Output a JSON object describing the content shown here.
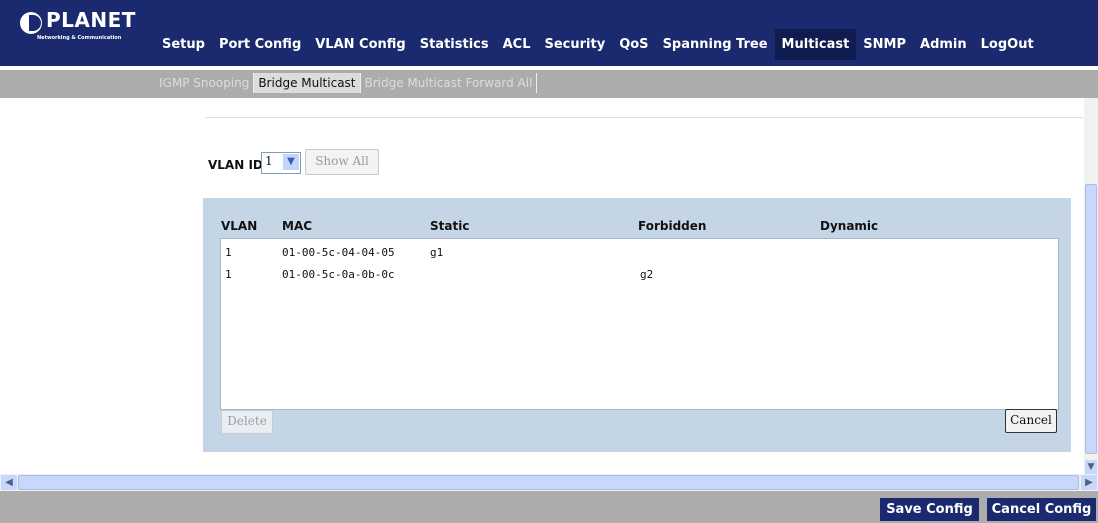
{
  "brand": {
    "name": "PLANET",
    "tagline": "Networking & Communication"
  },
  "nav": {
    "items": [
      "Setup",
      "Port Config",
      "VLAN Config",
      "Statistics",
      "ACL",
      "Security",
      "QoS",
      "Spanning Tree",
      "Multicast",
      "SNMP",
      "Admin",
      "LogOut"
    ],
    "active": "Multicast"
  },
  "subnav": {
    "items": [
      "IGMP Snooping",
      "Bridge Multicast",
      "Bridge Multicast Forward All"
    ],
    "active": "Bridge Multicast"
  },
  "filter": {
    "vlan_label": "VLAN ID",
    "vlan_value": "1",
    "show_all_label": "Show All"
  },
  "table": {
    "headers": {
      "vlan": "VLAN",
      "mac": "MAC",
      "static": "Static",
      "forbidden": "Forbidden",
      "dynamic": "Dynamic"
    },
    "rows": [
      {
        "vlan": "1",
        "mac": "01-00-5c-04-04-05",
        "static": "g1",
        "forbidden": "",
        "dynamic": ""
      },
      {
        "vlan": "1",
        "mac": "01-00-5c-0a-0b-0c",
        "static": "",
        "forbidden": "g2",
        "dynamic": ""
      }
    ],
    "delete_label": "Delete",
    "cancel_label": "Cancel"
  },
  "footer": {
    "save_label": "Save Config",
    "cancel_label": "Cancel Config"
  },
  "colors": {
    "nav_bg": "#1b2a6f",
    "active_nav_bg": "#101b4f",
    "panel_bg": "#c4d6e6",
    "bar_gray": "#acacad"
  }
}
